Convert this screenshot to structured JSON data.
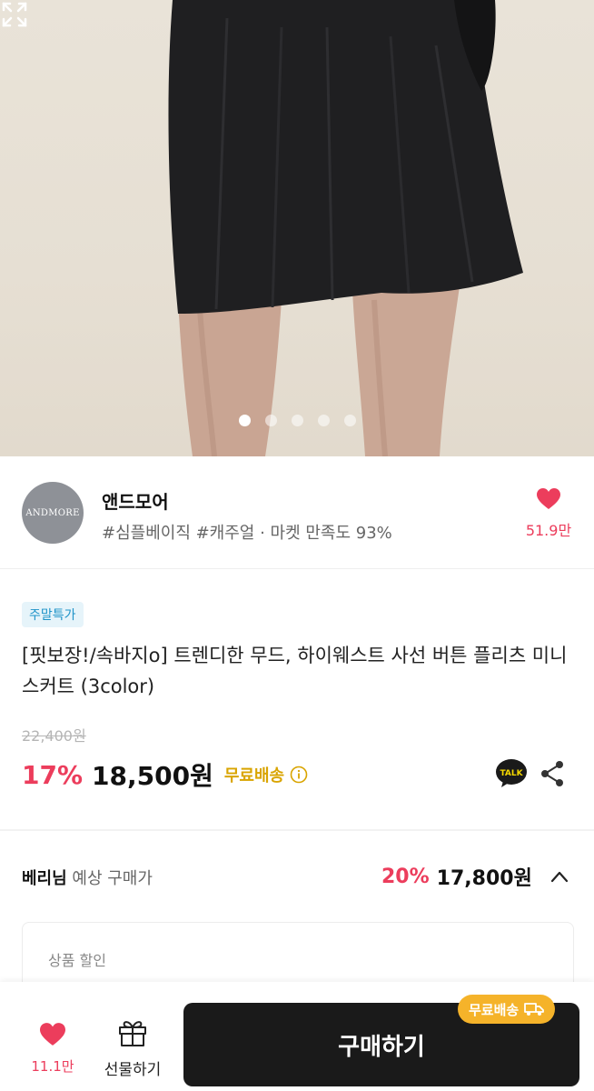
{
  "gallery": {
    "page_count": 5,
    "active_index": 0
  },
  "seller": {
    "avatar_text": "ANDMORE",
    "name": "앤드모어",
    "tags": "#심플베이직 #캐주얼 · 마켓 만족도 93%",
    "likes": "51.9만"
  },
  "product": {
    "badge": "주말특가",
    "title": "[핏보장!/속바지o] 트렌디한 무드, 하이웨스트 사선 버튼 플리츠 미니스커트 (3color)",
    "original_price": "22,400원",
    "discount": "17%",
    "price": "18,500원",
    "shipping": "무료배송",
    "talk_label": "TALK"
  },
  "expected": {
    "label_bold": "베리님",
    "label_rest": " 예상 구매가",
    "discount": "20%",
    "price": "17,800원",
    "box_label": "상품 할인"
  },
  "bottom_bar": {
    "like_count": "11.1만",
    "gift_label": "선물하기",
    "buy_label": "구매하기",
    "ship_tag": "무료배송"
  },
  "colors": {
    "accent_red": "#ec3d5c",
    "shipping_yellow": "#d9a400",
    "badge_blue": "#1e93c8",
    "button_dark": "#1a1a1a"
  },
  "icons": [
    "expand-icon",
    "heart-icon",
    "info-icon",
    "kakao-talk-icon",
    "share-icon",
    "chevron-up-icon",
    "gift-icon",
    "delivery-truck-icon"
  ]
}
